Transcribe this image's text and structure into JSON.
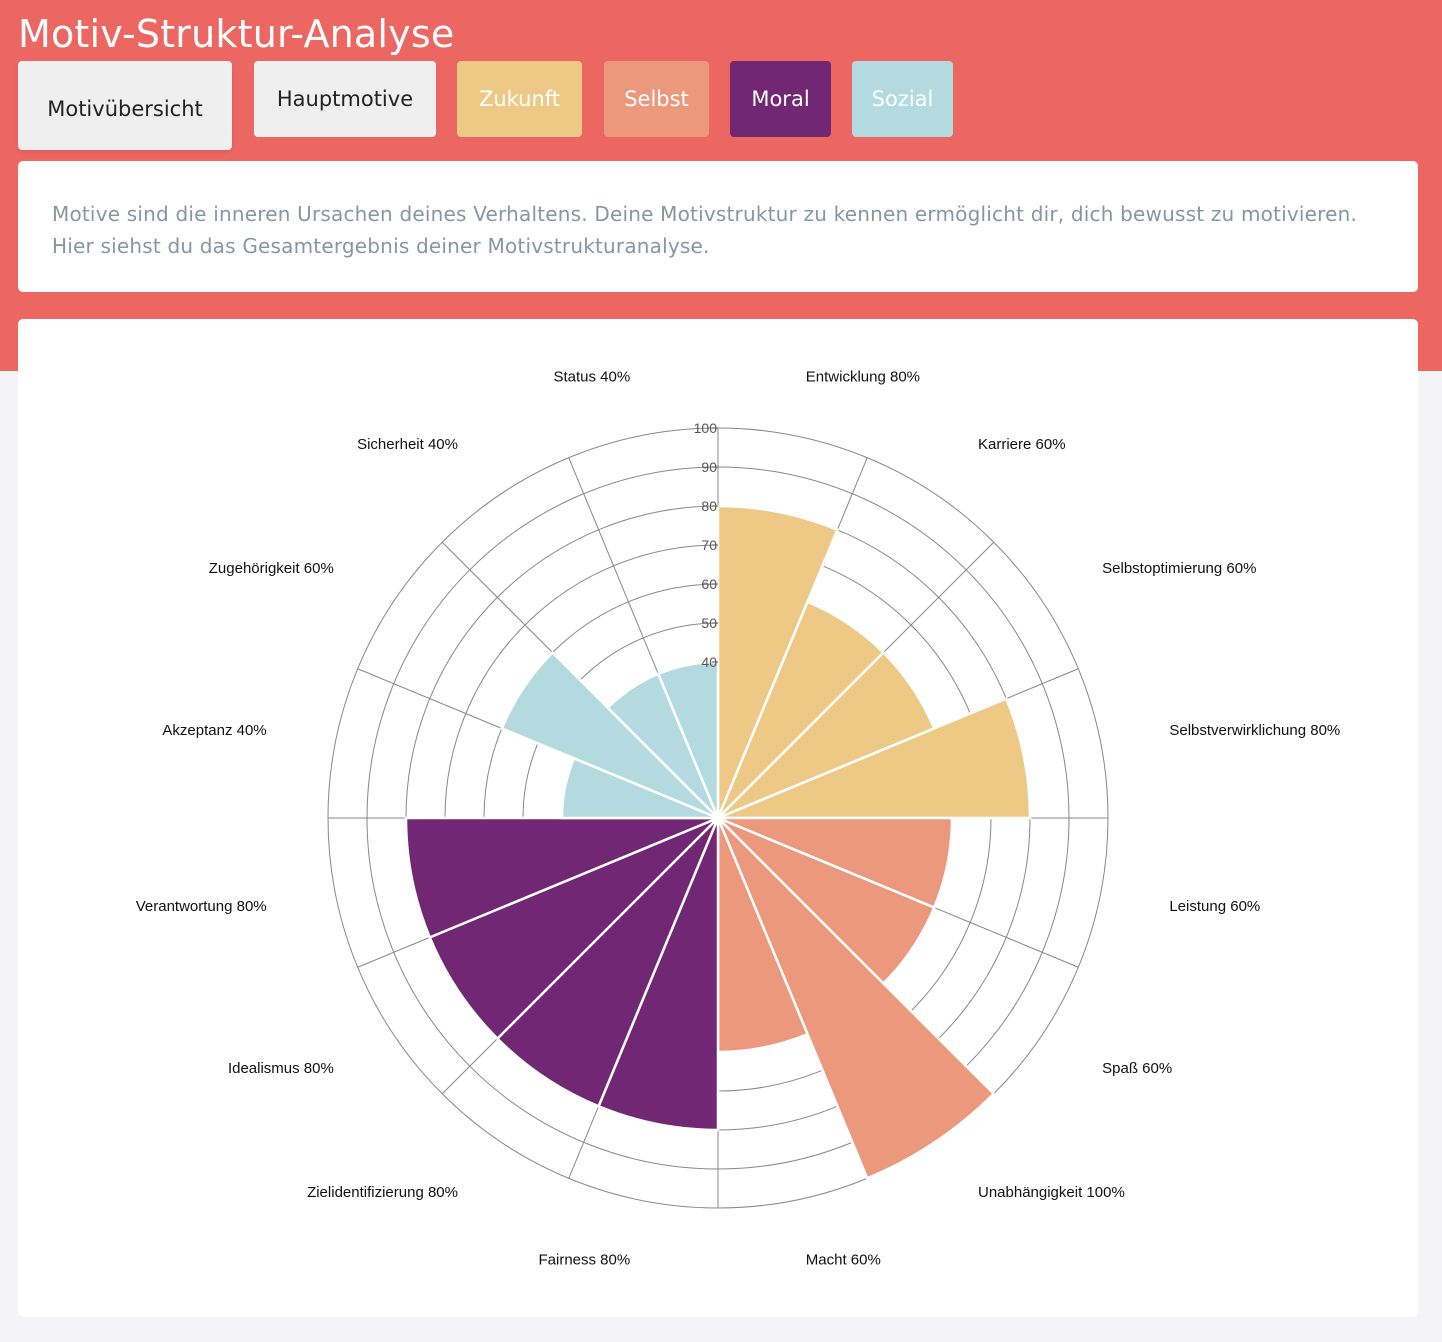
{
  "title": "Motiv-Struktur-Analyse",
  "tabs": [
    {
      "label": "Motivübersicht",
      "active": true,
      "color": "#efefef",
      "text_color": "#222222"
    },
    {
      "label": "Hauptmotive",
      "active": false,
      "color": "#efefef",
      "text_color": "#222222"
    },
    {
      "label": "Zukunft",
      "active": false,
      "color": "#eec885",
      "text_color": "#ffffff"
    },
    {
      "label": "Selbst",
      "active": false,
      "color": "#ec987c",
      "text_color": "#ffffff"
    },
    {
      "label": "Moral",
      "active": false,
      "color": "#712773",
      "text_color": "#ffffff"
    },
    {
      "label": "Sozial",
      "active": false,
      "color": "#b2dadf",
      "text_color": "#ffffff"
    }
  ],
  "description": "Motive sind die inneren Ursachen deines Verhaltens. Deine Motivstruktur zu kennen ermöglicht dir, dich bewusst zu motivieren. Hier siehst du das Gesamtergebnis deiner Motivstrukturanalyse.",
  "colors": {
    "header": "#ec6662",
    "zukunft": "#eec885",
    "selbst": "#ec987c",
    "moral": "#712773",
    "sozial": "#b2dadf"
  },
  "chart_data": {
    "type": "polar-area",
    "radial_ticks": [
      40,
      50,
      60,
      70,
      80,
      90,
      100
    ],
    "rlim": [
      0,
      100
    ],
    "grid": true,
    "categories": [
      "Entwicklung",
      "Karriere",
      "Selbstoptimierung",
      "Selbstverwirklichung",
      "Leistung",
      "Spaß",
      "Unabhängigkeit",
      "Macht",
      "Fairness",
      "Zielidentifizierung",
      "Idealismus",
      "Verantwortung",
      "Akzeptanz",
      "Zugehörigkeit",
      "Sicherheit",
      "Status"
    ],
    "values": [
      80,
      60,
      60,
      80,
      60,
      60,
      100,
      60,
      80,
      80,
      80,
      80,
      40,
      60,
      40,
      40
    ],
    "groups": [
      "zukunft",
      "zukunft",
      "zukunft",
      "zukunft",
      "selbst",
      "selbst",
      "selbst",
      "selbst",
      "moral",
      "moral",
      "moral",
      "moral",
      "sozial",
      "sozial",
      "sozial",
      "sozial"
    ],
    "labels": [
      "Entwicklung 80%",
      "Karriere 60%",
      "Selbstoptimierung 60%",
      "Selbstverwirklichung 80%",
      "Leistung 60%",
      "Spaß 60%",
      "Unabhängigkeit 100%",
      "Macht 60%",
      "Fairness 80%",
      "Zielidentifizierung 80%",
      "Idealismus 80%",
      "Verantwortung 80%",
      "Akzeptanz 40%",
      "Zugehörigkeit 60%",
      "Sicherheit 40%",
      "Status 40%"
    ]
  }
}
